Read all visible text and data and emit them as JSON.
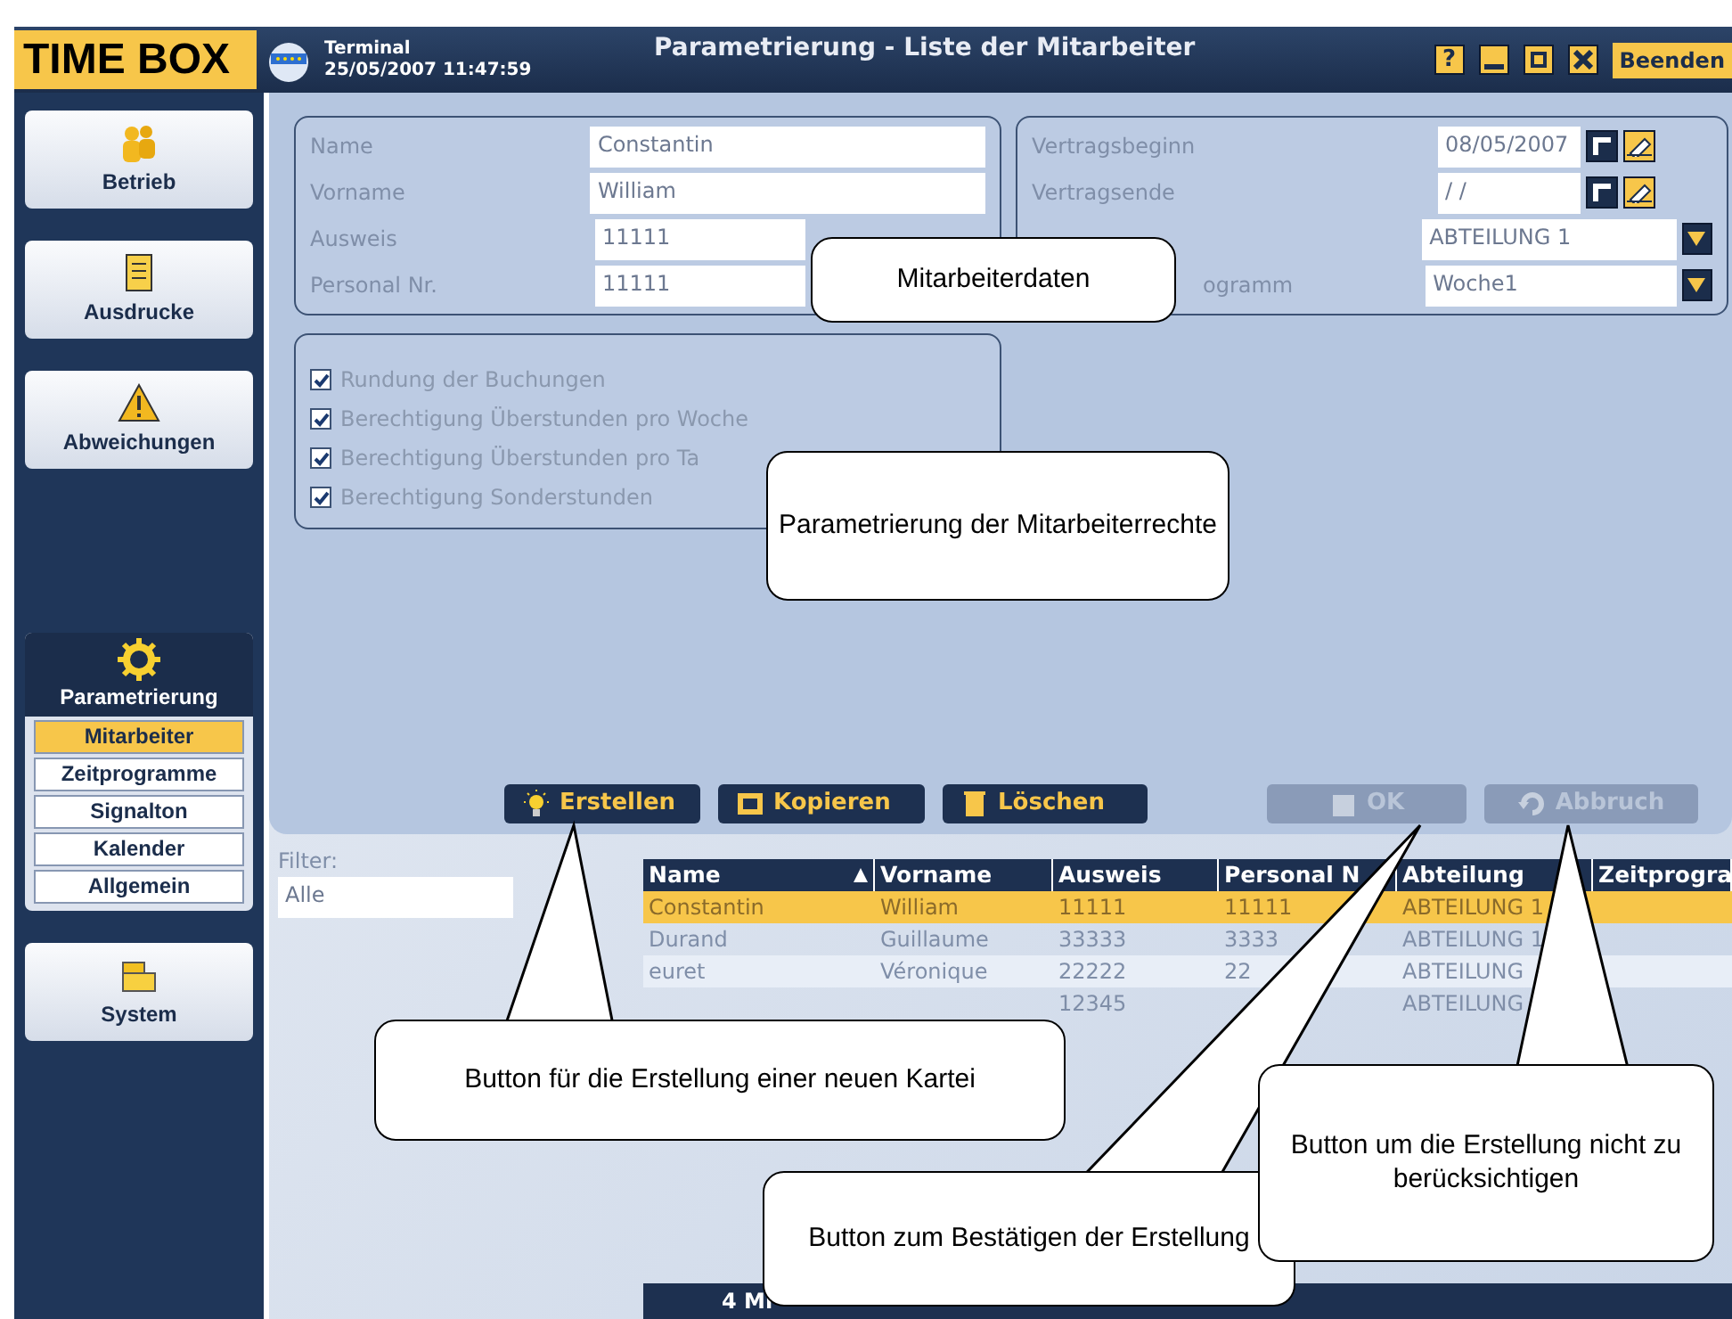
{
  "header": {
    "logo": "TIME BOX",
    "terminal": "Terminal",
    "datetime": "25/05/2007 11:47:59",
    "title": "Parametrierung - Liste der Mitarbeiter",
    "help": "?",
    "exit_button": "Beenden"
  },
  "sidebar": {
    "items": [
      {
        "label": "Betrieb",
        "kind": "button"
      },
      {
        "label": "Ausdrucke",
        "kind": "button"
      },
      {
        "label": "Abweichungen",
        "kind": "button"
      },
      {
        "label": "Parametrierung",
        "kind": "group",
        "children": [
          {
            "label": "Mitarbeiter",
            "selected": true
          },
          {
            "label": "Zeitprogramme",
            "selected": false
          },
          {
            "label": "Signalton",
            "selected": false
          },
          {
            "label": "Kalender",
            "selected": false
          },
          {
            "label": "Allgemein",
            "selected": false
          }
        ]
      },
      {
        "label": "System",
        "kind": "button"
      }
    ]
  },
  "employee_fields": [
    {
      "label": "Name",
      "value": "Constantin"
    },
    {
      "label": "Vorname",
      "value": "William"
    },
    {
      "label": "Ausweis",
      "value": "11111"
    },
    {
      "label": "Personal Nr.",
      "value": "11111"
    }
  ],
  "contract_fields": [
    {
      "label": "Vertragsbeginn",
      "value": "08/05/2007",
      "kind": "date"
    },
    {
      "label": "Vertragsende",
      "value": "/ /",
      "kind": "date"
    },
    {
      "value": "ABTEILUNG 1",
      "kind": "select"
    },
    {
      "label": "ogramm",
      "value": "Woche1",
      "kind": "select"
    }
  ],
  "permissions": [
    {
      "label": "Rundung der Buchungen",
      "checked": true
    },
    {
      "label": "Berechtigung Überstunden pro Woche",
      "checked": true
    },
    {
      "label": "Berechtigung Überstunden pro Ta",
      "checked": true
    },
    {
      "label": "Berechtigung Sonderstunden",
      "checked": true
    }
  ],
  "actions": [
    {
      "label": "Erstellen",
      "disabled": false
    },
    {
      "label": "Kopieren",
      "disabled": false
    },
    {
      "label": "Löschen",
      "disabled": false
    },
    {
      "label": "OK",
      "disabled": true
    },
    {
      "label": "Abbruch",
      "disabled": true
    }
  ],
  "filter": {
    "label": "Filter:",
    "value": "Alle"
  },
  "table": {
    "columns": [
      {
        "label": "Name",
        "sorted": true
      },
      {
        "label": "Vorname",
        "sorted": false
      },
      {
        "label": "Ausweis",
        "sorted": false
      },
      {
        "label": "Personal N",
        "sorted": false
      },
      {
        "label": "Abteilung",
        "sorted": false
      },
      {
        "label": "Zeitprogra",
        "sorted": false
      }
    ],
    "rows": [
      {
        "selected": true,
        "cells": [
          "Constantin",
          "William",
          "11111",
          "11111",
          "ABTEILUNG 1",
          null
        ]
      },
      {
        "selected": false,
        "cells": [
          "Durand",
          "Guillaume",
          "33333",
          "3333",
          "ABTEILUNG 1",
          null
        ]
      },
      {
        "selected": false,
        "cells": [
          "euret",
          "Véronique",
          "22222",
          "22",
          "ABTEILUNG",
          null
        ]
      },
      {
        "selected": false,
        "cells": [
          null,
          null,
          "12345",
          null,
          "ABTEILUNG",
          null
        ]
      }
    ],
    "footer": "4 Mi"
  },
  "callouts": [
    {
      "text": "Mitarbeiterdaten"
    },
    {
      "text": "Parametrierung der Mitarbeiterrechte"
    },
    {
      "text": "Button für die Erstellung einer neuen Kartei"
    },
    {
      "text": "Button zum Bestätigen der Erstellung"
    },
    {
      "text": "Button um die Erstellung nicht zu berücksichtigen"
    }
  ]
}
